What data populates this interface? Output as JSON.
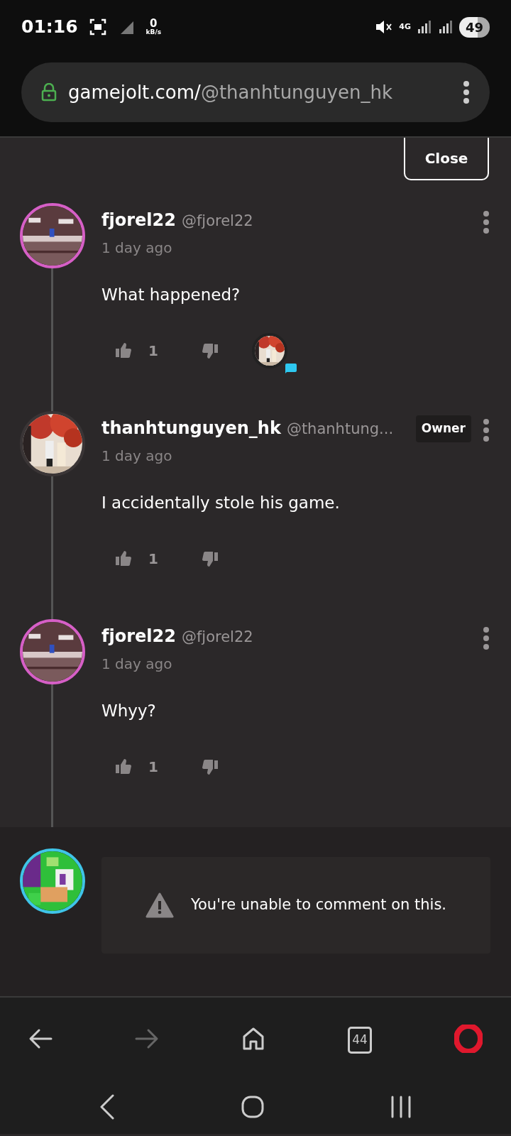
{
  "status_bar": {
    "time": "01:16",
    "net_speed": "0",
    "net_unit": "kB/s",
    "network": "4G",
    "battery": "49"
  },
  "address_bar": {
    "domain": "gamejolt.com/",
    "path": "@thanhtunguyen_hk"
  },
  "close_button": "Close",
  "comments": [
    {
      "display_name": "fjorel22",
      "username": "@fjorel22",
      "time": "1 day ago",
      "text": "What happened?",
      "likes": "1",
      "reply_avatar": true,
      "color": "#d65fc6"
    },
    {
      "display_name": "thanhtunguyen_hk",
      "username": "@thanhtung...",
      "badge": "Owner",
      "time": "1 day ago",
      "text": "I accidentally stole his game.",
      "likes": "1",
      "reply_avatar": false,
      "color": "#3a3536"
    },
    {
      "display_name": "fjorel22",
      "username": "@fjorel22",
      "time": "1 day ago",
      "text": "Whyy?",
      "likes": "1",
      "reply_avatar": false,
      "color": "#d65fc6"
    }
  ],
  "composer": {
    "color": "#3fc4e8",
    "notice": "You're unable to comment on this."
  },
  "browser_bar": {
    "tab_count": "44"
  }
}
